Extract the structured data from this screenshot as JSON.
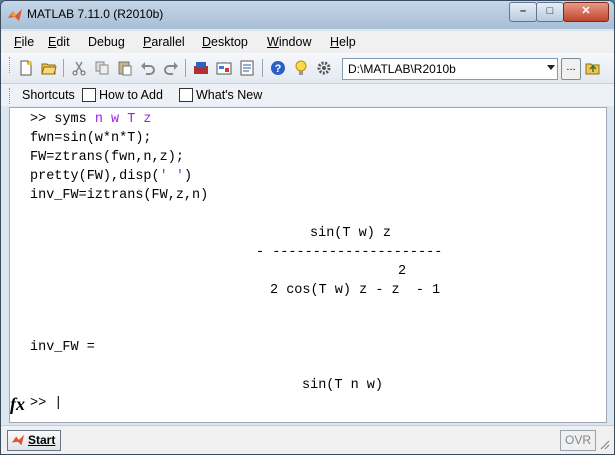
{
  "window": {
    "title": "MATLAB  7.11.0 (R2010b)"
  },
  "menu": [
    {
      "label": "File",
      "u": "F",
      "rest": "ile"
    },
    {
      "label": "Edit",
      "u": "E",
      "rest": "dit"
    },
    {
      "label": "Debug",
      "u": "",
      "rest": "Debug"
    },
    {
      "label": "Parallel",
      "u": "P",
      "rest": "arallel"
    },
    {
      "label": "Desktop",
      "u": "D",
      "rest": "esktop"
    },
    {
      "label": "Window",
      "u": "W",
      "rest": "indow"
    },
    {
      "label": "Help",
      "u": "H",
      "rest": "elp"
    }
  ],
  "toolbar": {
    "current_folder": "D:\\MATLAB\\R2010b",
    "browse_label": "..."
  },
  "shortcuts": {
    "label": "Shortcuts",
    "how_to_add": "How to Add",
    "whats_new": "What's New"
  },
  "console": {
    "line1_prompt": ">> syms ",
    "line1_args": "n w T z",
    "line2": "fwn=sin(w*n*T);",
    "line3": "FW=ztrans(fwn,n,z);",
    "line4_a": "pretty(FW),disp(",
    "line4_str": "' '",
    "line4_b": ")",
    "line5": "inv_FW=iztrans(FW,z,n)",
    "pretty_num": "sin(T w) z",
    "pretty_bar": "- ---------------------",
    "pretty_exp": "2",
    "pretty_den": "2 cos(T w) z - z  - 1",
    "inv_label": "inv_FW =",
    "result": "sin(T n w)",
    "prompt": ">> |",
    "fx": "fx"
  },
  "status": {
    "start_label": "Start",
    "ovr": "OVR"
  }
}
